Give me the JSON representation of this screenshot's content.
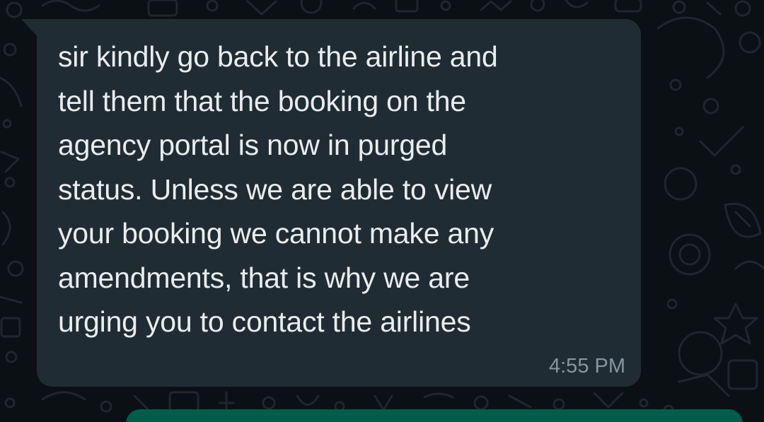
{
  "chat": {
    "incoming_message": {
      "lines": [
        "sir kindly go back to the airline and",
        "tell them that the booking on the",
        "agency portal is now in purged",
        "status. Unless we are able to view",
        "your booking we cannot make any",
        "amendments, that is why we are",
        "urging you to contact the airlines"
      ],
      "time": "4:55 PM"
    }
  },
  "colors": {
    "background": "#0b1014",
    "incoming_bubble": "#202c33",
    "outgoing_bubble": "#005c4b",
    "message_text": "#e9edef",
    "timestamp": "#8696a0",
    "doodle_stroke": "#1f272c"
  }
}
